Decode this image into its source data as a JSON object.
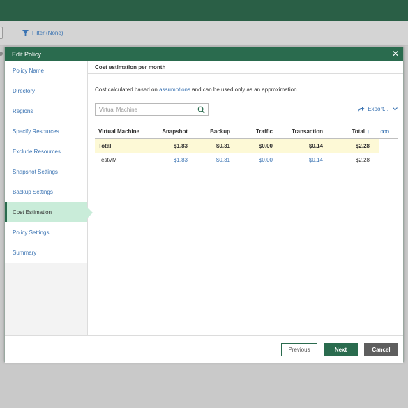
{
  "toolbar": {
    "filter_label": "Filter (None)"
  },
  "dialog": {
    "title": "Edit Policy",
    "close_glyph": "✕",
    "nav": [
      {
        "label": "Policy Name",
        "active": false
      },
      {
        "label": "Directory",
        "active": false
      },
      {
        "label": "Regions",
        "active": false
      },
      {
        "label": "Specify Resources",
        "active": false
      },
      {
        "label": "Exclude Resources",
        "active": false
      },
      {
        "label": "Snapshot Settings",
        "active": false
      },
      {
        "label": "Backup Settings",
        "active": false
      },
      {
        "label": "Cost Estimation",
        "active": true
      },
      {
        "label": "Policy Settings",
        "active": false
      },
      {
        "label": "Summary",
        "active": false
      }
    ]
  },
  "content": {
    "section_title": "Cost estimation per month",
    "desc_prefix": "Cost calculated based on",
    "desc_link": "assumptions",
    "desc_suffix": "and can be used only as an approximation.",
    "search": {
      "placeholder": "Virtual Machine",
      "value": ""
    },
    "export_label": "Export..."
  },
  "table": {
    "columns": [
      "Virtual Machine",
      "Snapshot",
      "Backup",
      "Traffic",
      "Transaction",
      "Total"
    ],
    "sort_arrow": "↓",
    "columns_menu_glyph": "ooo",
    "total_row": [
      "Total",
      "$1.83",
      "$0.31",
      "$0.00",
      "$0.14",
      "$2.28"
    ],
    "rows": [
      [
        "TestVM",
        "$1.83",
        "$0.31",
        "$0.00",
        "$0.14",
        "$2.28"
      ]
    ]
  },
  "footer": {
    "previous_label": "Previous",
    "next_label": "Next",
    "cancel_label": "Cancel"
  },
  "colors": {
    "header_green": "#2a6b4e",
    "link_blue": "#3a73b2",
    "active_nav": "#c9ecd9",
    "total_row_bg": "#fdf9d6",
    "cancel_gray": "#5e5e5e"
  }
}
